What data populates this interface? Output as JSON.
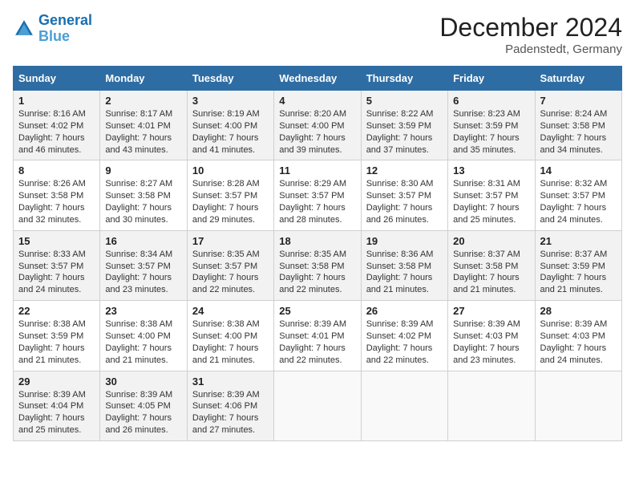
{
  "logo": {
    "line1": "General",
    "line2": "Blue"
  },
  "title": "December 2024",
  "location": "Padenstedt, Germany",
  "weekdays": [
    "Sunday",
    "Monday",
    "Tuesday",
    "Wednesday",
    "Thursday",
    "Friday",
    "Saturday"
  ],
  "weeks": [
    [
      {
        "day": "1",
        "rise": "8:16 AM",
        "set": "4:02 PM",
        "daylight": "7 hours and 46 minutes."
      },
      {
        "day": "2",
        "rise": "8:17 AM",
        "set": "4:01 PM",
        "daylight": "7 hours and 43 minutes."
      },
      {
        "day": "3",
        "rise": "8:19 AM",
        "set": "4:00 PM",
        "daylight": "7 hours and 41 minutes."
      },
      {
        "day": "4",
        "rise": "8:20 AM",
        "set": "4:00 PM",
        "daylight": "7 hours and 39 minutes."
      },
      {
        "day": "5",
        "rise": "8:22 AM",
        "set": "3:59 PM",
        "daylight": "7 hours and 37 minutes."
      },
      {
        "day": "6",
        "rise": "8:23 AM",
        "set": "3:59 PM",
        "daylight": "7 hours and 35 minutes."
      },
      {
        "day": "7",
        "rise": "8:24 AM",
        "set": "3:58 PM",
        "daylight": "7 hours and 34 minutes."
      }
    ],
    [
      {
        "day": "8",
        "rise": "8:26 AM",
        "set": "3:58 PM",
        "daylight": "7 hours and 32 minutes."
      },
      {
        "day": "9",
        "rise": "8:27 AM",
        "set": "3:58 PM",
        "daylight": "7 hours and 30 minutes."
      },
      {
        "day": "10",
        "rise": "8:28 AM",
        "set": "3:57 PM",
        "daylight": "7 hours and 29 minutes."
      },
      {
        "day": "11",
        "rise": "8:29 AM",
        "set": "3:57 PM",
        "daylight": "7 hours and 28 minutes."
      },
      {
        "day": "12",
        "rise": "8:30 AM",
        "set": "3:57 PM",
        "daylight": "7 hours and 26 minutes."
      },
      {
        "day": "13",
        "rise": "8:31 AM",
        "set": "3:57 PM",
        "daylight": "7 hours and 25 minutes."
      },
      {
        "day": "14",
        "rise": "8:32 AM",
        "set": "3:57 PM",
        "daylight": "7 hours and 24 minutes."
      }
    ],
    [
      {
        "day": "15",
        "rise": "8:33 AM",
        "set": "3:57 PM",
        "daylight": "7 hours and 24 minutes."
      },
      {
        "day": "16",
        "rise": "8:34 AM",
        "set": "3:57 PM",
        "daylight": "7 hours and 23 minutes."
      },
      {
        "day": "17",
        "rise": "8:35 AM",
        "set": "3:57 PM",
        "daylight": "7 hours and 22 minutes."
      },
      {
        "day": "18",
        "rise": "8:35 AM",
        "set": "3:58 PM",
        "daylight": "7 hours and 22 minutes."
      },
      {
        "day": "19",
        "rise": "8:36 AM",
        "set": "3:58 PM",
        "daylight": "7 hours and 21 minutes."
      },
      {
        "day": "20",
        "rise": "8:37 AM",
        "set": "3:58 PM",
        "daylight": "7 hours and 21 minutes."
      },
      {
        "day": "21",
        "rise": "8:37 AM",
        "set": "3:59 PM",
        "daylight": "7 hours and 21 minutes."
      }
    ],
    [
      {
        "day": "22",
        "rise": "8:38 AM",
        "set": "3:59 PM",
        "daylight": "7 hours and 21 minutes."
      },
      {
        "day": "23",
        "rise": "8:38 AM",
        "set": "4:00 PM",
        "daylight": "7 hours and 21 minutes."
      },
      {
        "day": "24",
        "rise": "8:38 AM",
        "set": "4:00 PM",
        "daylight": "7 hours and 21 minutes."
      },
      {
        "day": "25",
        "rise": "8:39 AM",
        "set": "4:01 PM",
        "daylight": "7 hours and 22 minutes."
      },
      {
        "day": "26",
        "rise": "8:39 AM",
        "set": "4:02 PM",
        "daylight": "7 hours and 22 minutes."
      },
      {
        "day": "27",
        "rise": "8:39 AM",
        "set": "4:03 PM",
        "daylight": "7 hours and 23 minutes."
      },
      {
        "day": "28",
        "rise": "8:39 AM",
        "set": "4:03 PM",
        "daylight": "7 hours and 24 minutes."
      }
    ],
    [
      {
        "day": "29",
        "rise": "8:39 AM",
        "set": "4:04 PM",
        "daylight": "7 hours and 25 minutes."
      },
      {
        "day": "30",
        "rise": "8:39 AM",
        "set": "4:05 PM",
        "daylight": "7 hours and 26 minutes."
      },
      {
        "day": "31",
        "rise": "8:39 AM",
        "set": "4:06 PM",
        "daylight": "7 hours and 27 minutes."
      },
      null,
      null,
      null,
      null
    ]
  ],
  "labels": {
    "sunrise": "Sunrise:",
    "sunset": "Sunset:",
    "daylight": "Daylight:"
  }
}
